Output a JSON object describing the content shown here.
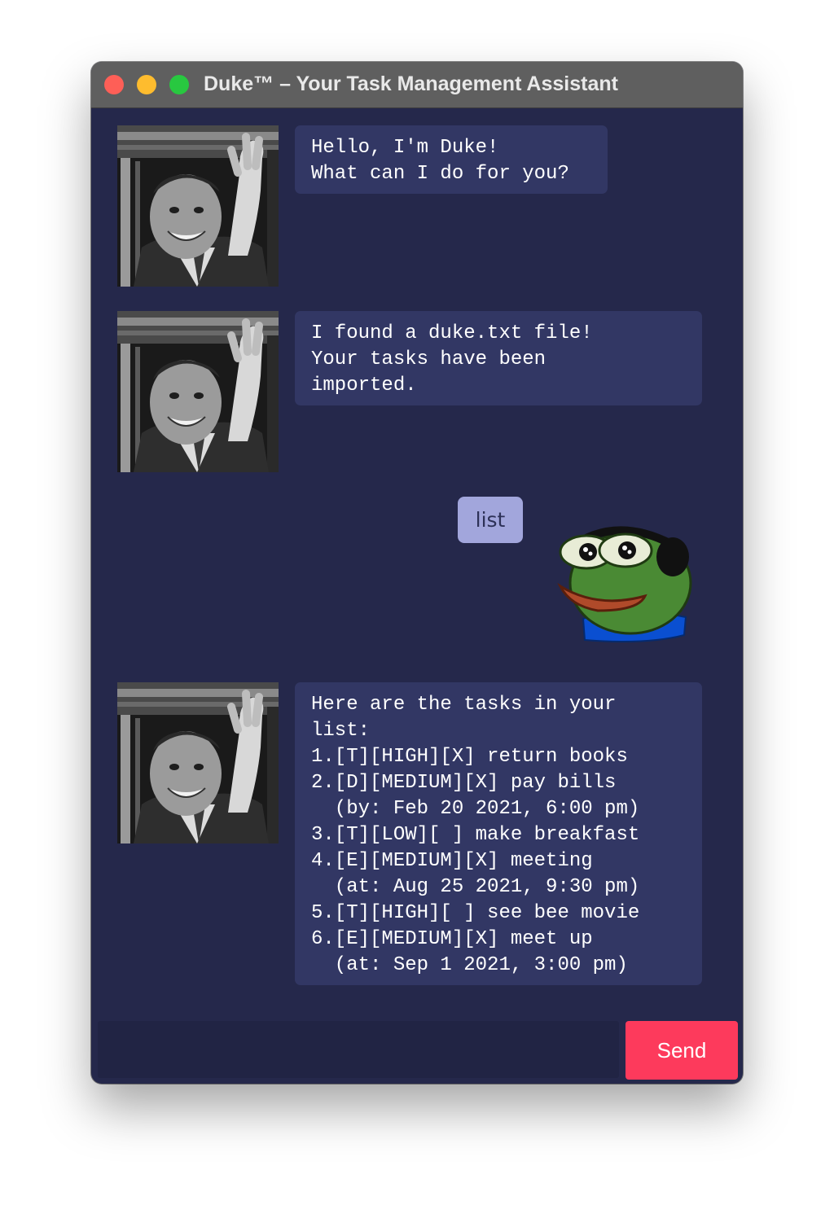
{
  "window": {
    "title": "Duke™ – Your Task Management Assistant"
  },
  "chat": {
    "messages": [
      {
        "sender": "duke",
        "text": "Hello, I'm Duke!\nWhat can I do for you?"
      },
      {
        "sender": "duke",
        "text": "I found a duke.txt file!\nYour tasks have been\nimported."
      },
      {
        "sender": "user",
        "text": "list"
      },
      {
        "sender": "duke",
        "text": "Here are the tasks in your\nlist:\n1.[T][HIGH][X] return books\n2.[D][MEDIUM][X] pay bills\n  (by: Feb 20 2021, 6:00 pm)\n3.[T][LOW][ ] make breakfast\n4.[E][MEDIUM][X] meeting\n  (at: Aug 25 2021, 9:30 pm)\n5.[T][HIGH][ ] see bee movie\n6.[E][MEDIUM][X] meet up\n  (at: Sep 1 2021, 3:00 pm)"
      }
    ]
  },
  "input": {
    "value": "",
    "placeholder": ""
  },
  "send_button": {
    "label": "Send"
  },
  "colors": {
    "background": "#25284b",
    "duke_bubble": "#323764",
    "user_bubble": "#a2a6dc",
    "send_button": "#fd3a5c",
    "titlebar": "#5f5f5f"
  },
  "icons": {
    "duke_avatar": "duke-ellington-photo",
    "user_avatar": "pepe-headphones"
  }
}
